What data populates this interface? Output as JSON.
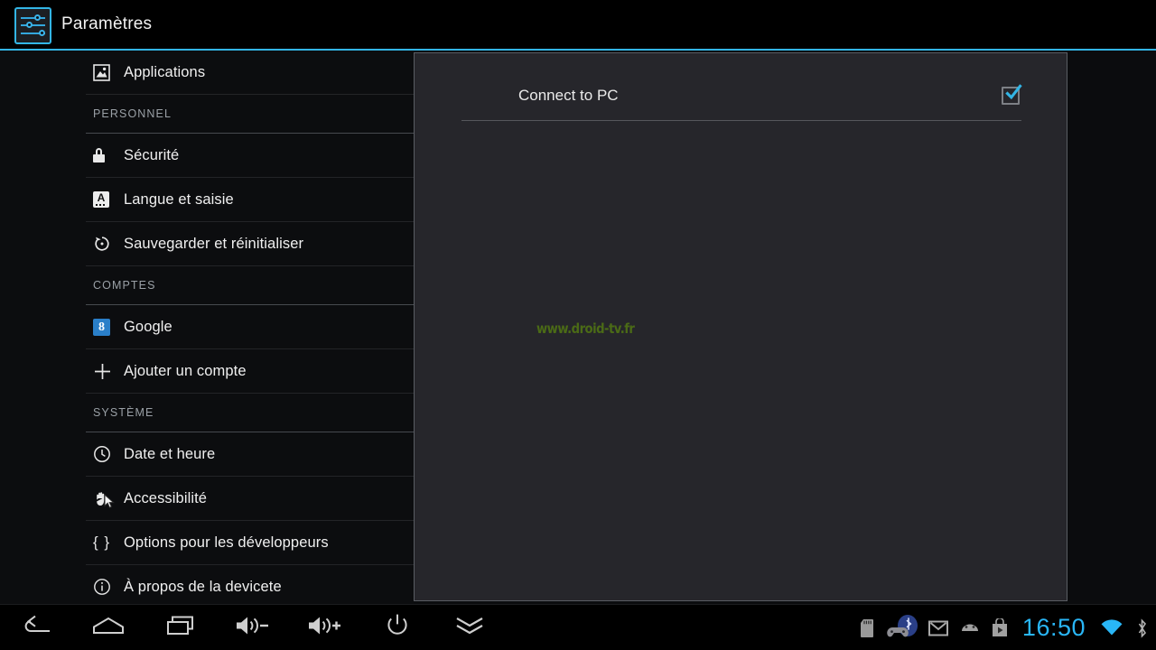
{
  "window": {
    "title": "Paramètres",
    "app_icon": "settings-sliders-icon",
    "accent_color": "#33b5e5",
    "background_color": "#000000"
  },
  "sidebar": {
    "panel_color": "#0c0d0f",
    "items": [
      {
        "type": "item",
        "label": "Applications",
        "icon": "applications-icon"
      },
      {
        "type": "section",
        "label": "PERSONNEL"
      },
      {
        "type": "item",
        "label": "Sécurité",
        "icon": "lock-icon"
      },
      {
        "type": "item",
        "label": "Langue et saisie",
        "icon": "keyboard-language-icon"
      },
      {
        "type": "item",
        "label": "Sauvegarder et réinitialiser",
        "icon": "restore-icon"
      },
      {
        "type": "section",
        "label": "COMPTES"
      },
      {
        "type": "item",
        "label": "Google",
        "icon": "google-icon"
      },
      {
        "type": "item",
        "label": "Ajouter un compte",
        "icon": "plus-icon"
      },
      {
        "type": "section",
        "label": "SYSTÈME"
      },
      {
        "type": "item",
        "label": "Date et heure",
        "icon": "clock-icon"
      },
      {
        "type": "item",
        "label": "Accessibilité",
        "icon": "hand-accessibility-icon"
      },
      {
        "type": "item",
        "label": "Options pour les développeurs",
        "icon": "braces-icon"
      },
      {
        "type": "item",
        "label": "À propos de la devicete",
        "icon": "info-icon"
      }
    ]
  },
  "detail": {
    "panel_color": "#26262b",
    "rows": [
      {
        "label": "Connect to PC",
        "checked": true,
        "checkbox_color": "#33b5e5"
      }
    ],
    "watermark": "www.droid-tv.fr",
    "watermark_color": "#4b6b16"
  },
  "navbar": {
    "buttons": [
      {
        "name": "back-icon",
        "label": "Retour"
      },
      {
        "name": "home-icon",
        "label": "Accueil"
      },
      {
        "name": "recents-icon",
        "label": "Applications récentes"
      },
      {
        "name": "volume-down-icon",
        "label": "Volume -"
      },
      {
        "name": "volume-up-icon",
        "label": "Volume +"
      },
      {
        "name": "power-icon",
        "label": "Alimentation"
      },
      {
        "name": "expand-notifications-icon",
        "label": "Notifications"
      }
    ],
    "status": {
      "icons": [
        {
          "name": "sd-card-icon",
          "label": "Carte SD"
        },
        {
          "name": "gamepad-bluetooth-icon",
          "label": "Manette Bluetooth"
        },
        {
          "name": "gmail-icon",
          "label": "Gmail"
        },
        {
          "name": "android-icon",
          "label": "Android"
        },
        {
          "name": "play-store-icon",
          "label": "Play Store"
        }
      ],
      "clock": "16:50",
      "clock_color": "#29b6f6",
      "right_icons": [
        {
          "name": "wifi-icon",
          "label": "Wi-Fi"
        },
        {
          "name": "bluetooth-icon",
          "label": "Bluetooth"
        }
      ]
    }
  }
}
